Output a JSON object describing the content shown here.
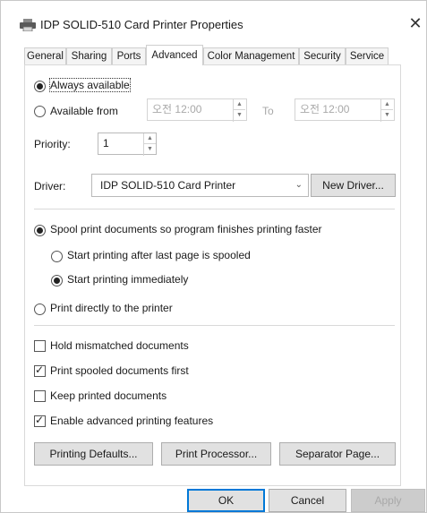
{
  "window": {
    "title": "IDP SOLID-510 Card Printer Properties",
    "close_glyph": "✕"
  },
  "tabs": [
    {
      "label": "General"
    },
    {
      "label": "Sharing"
    },
    {
      "label": "Ports"
    },
    {
      "label": "Advanced"
    },
    {
      "label": "Color Management"
    },
    {
      "label": "Security"
    },
    {
      "label": "Service"
    }
  ],
  "availability": {
    "always_label": "Always available",
    "from_label": "Available from",
    "from_time": "오전 12:00",
    "to_label": "To",
    "to_time": "오전 12:00"
  },
  "priority": {
    "label": "Priority:",
    "value": "1"
  },
  "driver": {
    "label": "Driver:",
    "selected": "IDP SOLID-510 Card Printer",
    "new_driver_button": "New Driver..."
  },
  "spooling": {
    "spool_label": "Spool print documents so program finishes printing faster",
    "after_last_label": "Start printing after last page is spooled",
    "immediately_label": "Start printing immediately",
    "direct_label": "Print directly to the printer"
  },
  "options": {
    "hold_label": "Hold mismatched documents",
    "spooled_first_label": "Print spooled documents first",
    "keep_label": "Keep printed documents",
    "advanced_label": "Enable advanced printing features"
  },
  "buttons": {
    "printing_defaults": "Printing Defaults...",
    "print_processor": "Print Processor...",
    "separator_page": "Separator Page...",
    "ok": "OK",
    "cancel": "Cancel",
    "apply": "Apply"
  },
  "state": {
    "always_available": true,
    "spool": true,
    "start_immediately": true,
    "hold_mismatched": false,
    "print_spooled_first": true,
    "keep_printed": false,
    "enable_advanced": true
  },
  "colors": {
    "default_button_border": "#0078d7",
    "disabled_text": "#a8a8a8"
  },
  "icons": {
    "title": "printer-icon",
    "close": "close-icon"
  }
}
